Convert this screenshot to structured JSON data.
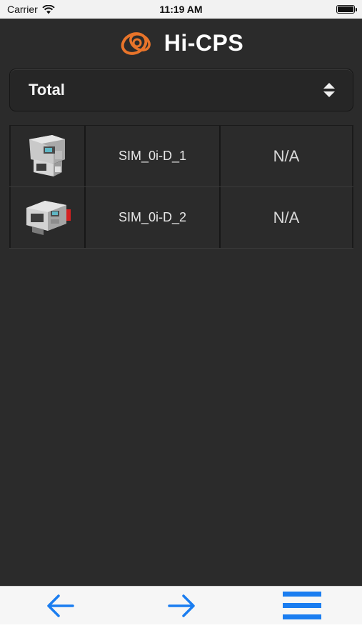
{
  "status_bar": {
    "carrier": "Carrier",
    "time": "11:19 AM",
    "wifi_icon": "wifi-icon",
    "battery_icon": "battery-icon"
  },
  "header": {
    "title": "Hi-CPS",
    "logo_icon": "hi-cps-logo-icon",
    "logo_color": "#e8742a"
  },
  "filter": {
    "selected": "Total",
    "icon": "sort-updown-icon"
  },
  "machines": [
    {
      "name": "SIM_0i-D_1",
      "status": "N/A",
      "image_icon": "cnc-machine-icon"
    },
    {
      "name": "SIM_0i-D_2",
      "status": "N/A",
      "image_icon": "cnc-lathe-icon"
    }
  ],
  "toolbar": {
    "back_icon": "arrow-left-icon",
    "forward_icon": "arrow-right-icon",
    "menu_icon": "hamburger-menu-icon",
    "accent": "#1a7df0"
  }
}
